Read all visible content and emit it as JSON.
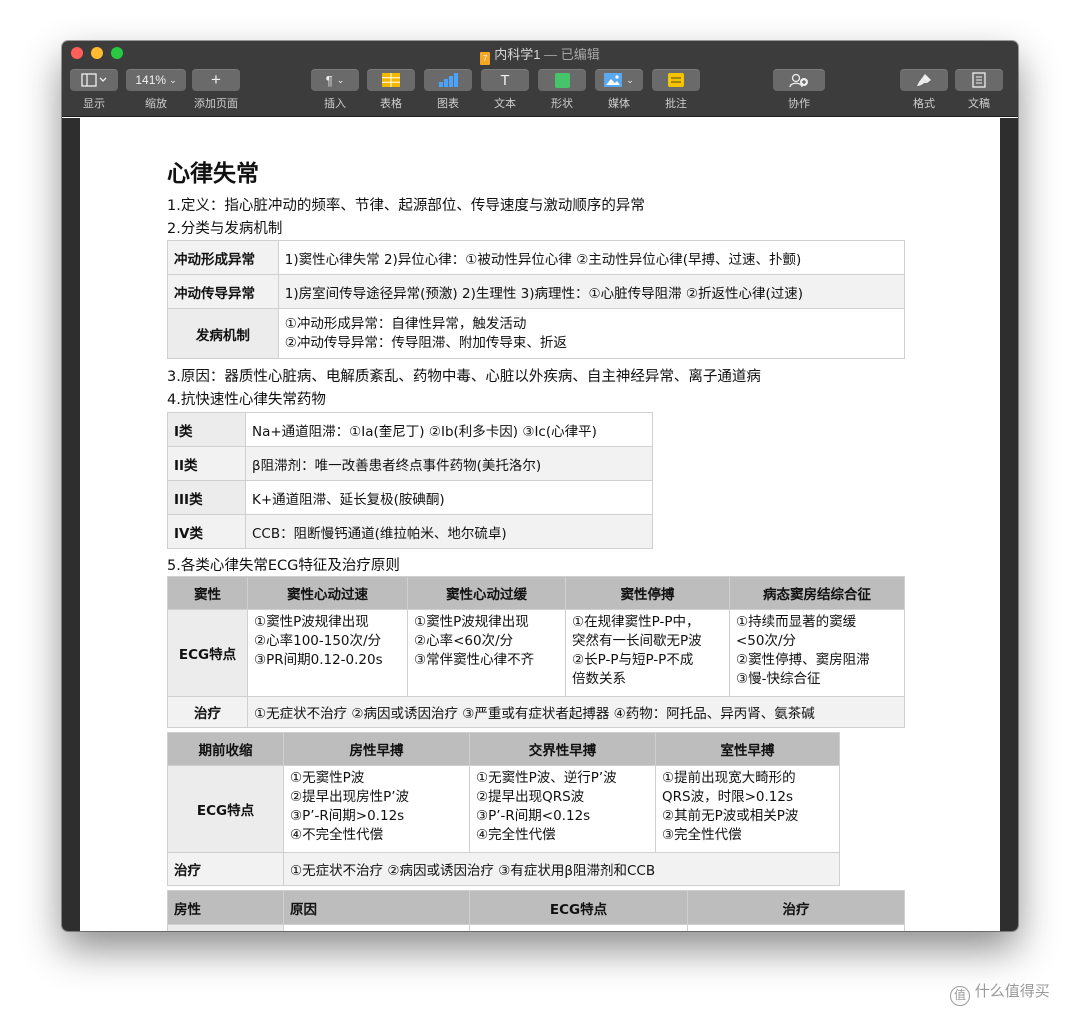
{
  "window": {
    "title": "内科学1",
    "title_suffix": "— 已编辑",
    "file_icon": "7"
  },
  "toolbar": {
    "view": {
      "label": "显示"
    },
    "zoom": {
      "value": "141%",
      "label": "缩放"
    },
    "add_page": {
      "label": "添加页面"
    },
    "insert": {
      "label": "插入"
    },
    "table": {
      "label": "表格"
    },
    "chart": {
      "label": "图表"
    },
    "text": {
      "label": "文本"
    },
    "shape": {
      "label": "形状"
    },
    "media": {
      "label": "媒体"
    },
    "comment": {
      "label": "批注"
    },
    "collaborate": {
      "label": "协作"
    },
    "format": {
      "label": "格式"
    },
    "document": {
      "label": "文稿"
    }
  },
  "doc": {
    "title": "心律失常",
    "s1": "1.定义：指心脏冲动的频率、节律、起源部位、传导速度与激动顺序的异常",
    "s2": "2.分类与发病机制",
    "t1": {
      "r1k": "冲动形成异常",
      "r1v": "1)窦性心律失常 2)异位心律：①被动性异位心律 ②主动性异位心律(早搏、过速、扑颤)",
      "r2k": "冲动传导异常",
      "r2v": "1)房室间传导途径异常(预激) 2)生理性 3)病理性：①心脏传导阻滞 ②折返性心律(过速)",
      "r3k": "发病机制",
      "r3v1": "①冲动形成异常：自律性异常，触发活动",
      "r3v2": "②冲动传导异常：传导阻滞、附加传导束、折返"
    },
    "s3": "3.原因：器质性心脏病、电解质紊乱、药物中毒、心脏以外疾病、自主神经异常、离子通道病",
    "s4": "4.抗快速性心律失常药物",
    "t2": {
      "r1k": "I类",
      "r1v": "Na+通道阻滞：①Ia(奎尼丁) ②Ib(利多卡因) ③Ic(心律平)",
      "r2k": "II类",
      "r2v": "β阻滞剂：唯一改善患者终点事件药物(美托洛尔)",
      "r3k": "III类",
      "r3v": "K+通道阻滞、延长复极(胺碘酮)",
      "r4k": "IV类",
      "r4v": "CCB：阻断慢钙通道(维拉帕米、地尔硫卓)"
    },
    "s5": "5.各类心律失常ECG特征及治疗原则",
    "t3": {
      "h": [
        "窦性",
        "窦性心动过速",
        "窦性心动过缓",
        "窦性停搏",
        "病态窦房结综合征"
      ],
      "ecg_k": "ECG特点",
      "c1": [
        "①窦性P波规律出现",
        "②心率100-150次/分",
        "③PR间期0.12-0.20s"
      ],
      "c2": [
        "①窦性P波规律出现",
        "②心率<60次/分",
        "③常伴窦性心律不齐"
      ],
      "c3": [
        "①在规律窦性P-P中，",
        "突然有一长间歇无P波",
        "②长P-P与短P-P不成",
        "倍数关系"
      ],
      "c4": [
        "①持续而显著的窦缓",
        "<50次/分",
        "②窦性停搏、窦房阻滞",
        "③慢-快综合征"
      ],
      "tx_k": "治疗",
      "tx": "①无症状不治疗 ②病因或诱因治疗 ③严重或有症状者起搏器 ④药物：阿托品、异丙肾、氨茶碱"
    },
    "t4": {
      "h": [
        "期前收缩",
        "房性早搏",
        "交界性早搏",
        "室性早搏"
      ],
      "ecg_k": "ECG特点",
      "c1": [
        "①无窦性P波",
        "②提早出现房性P’波",
        "③P’-R间期>0.12s",
        "④不完全性代偿"
      ],
      "c2": [
        "①无窦性P波、逆行P’波",
        "②提早出现QRS波",
        "③P’-R间期<0.12s",
        "④完全性代偿"
      ],
      "c3": [
        "①提前出现宽大畸形的",
        "QRS波，时限>0.12s",
        "②其前无P波或相关P波",
        "③完全性代偿"
      ],
      "tx_k": "治疗",
      "tx": "①无症状不治疗 ②病因或诱因治疗 ③有症状用β阻滞剂和CCB"
    },
    "t5": {
      "h": [
        "房性",
        "原因",
        "ECG特点",
        "治疗"
      ]
    }
  },
  "watermark": "什么值得买"
}
